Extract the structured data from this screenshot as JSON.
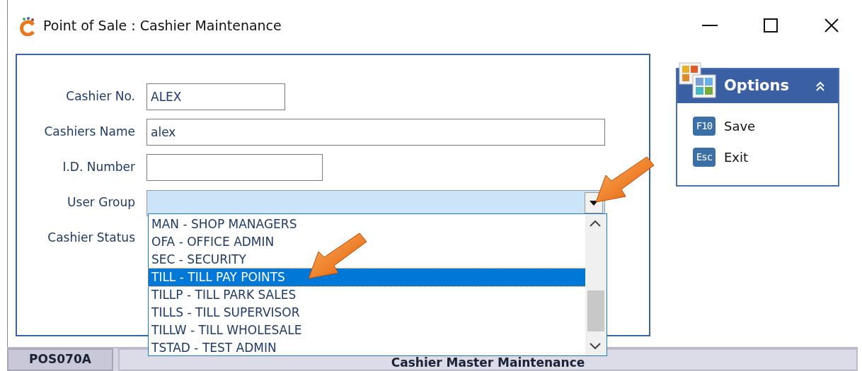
{
  "window": {
    "title": "Point of Sale : Cashier Maintenance"
  },
  "form": {
    "fields": [
      {
        "label": "Cashier No.",
        "value": "ALEX"
      },
      {
        "label": "Cashiers Name",
        "value": "alex"
      },
      {
        "label": "I.D. Number"
      }
    ],
    "user_group": {
      "label": "User Group",
      "expanded": true,
      "options": [
        {
          "label": "MAN - SHOP MANAGERS",
          "selected": false
        },
        {
          "label": "OFA - OFFICE ADMIN",
          "selected": false
        },
        {
          "label": "SEC - SECURITY",
          "selected": false
        },
        {
          "label": "TILL - TILL PAY POINTS",
          "selected": true
        },
        {
          "label": "TILLP - TILL PARK SALES",
          "selected": false
        },
        {
          "label": "TILLS - TILL SUPERVISOR",
          "selected": false
        },
        {
          "label": "TILLW - TILL WHOLESALE",
          "selected": false
        },
        {
          "label": "TSTAD - TEST ADMIN",
          "selected": false
        }
      ]
    },
    "cashier_status": {
      "label": "Cashier Status"
    }
  },
  "options_panel": {
    "title": "Options",
    "expanded": true,
    "items": [
      {
        "key": "F10",
        "label": "Save"
      },
      {
        "key": "Esc",
        "label": "Exit"
      }
    ]
  },
  "status_bar": {
    "code": "POS070A",
    "title": "Cashier Master Maintenance"
  }
}
